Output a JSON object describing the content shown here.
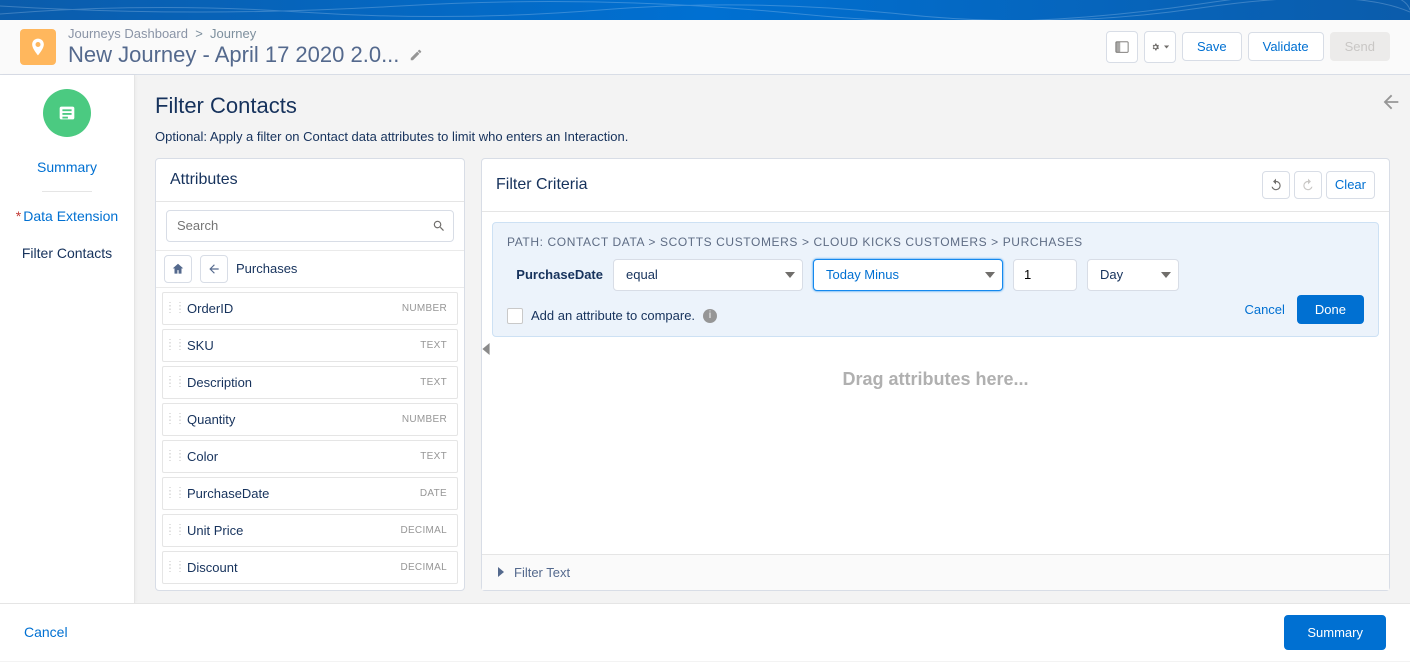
{
  "header": {
    "breadcrumb_dashboard": "Journeys Dashboard",
    "breadcrumb_journey": "Journey",
    "title": "New Journey - April 17 2020 2.0...",
    "actions": {
      "save": "Save",
      "validate": "Validate",
      "send": "Send"
    }
  },
  "nav": {
    "summary": "Summary",
    "data_extension": "Data Extension",
    "filter_contacts": "Filter Contacts"
  },
  "main": {
    "title": "Filter Contacts",
    "desc": "Optional: Apply a filter on Contact data attributes to limit who enters an Interaction."
  },
  "attributes_panel": {
    "title": "Attributes",
    "search_placeholder": "Search",
    "crumb": "Purchases",
    "items": [
      {
        "name": "OrderID",
        "type": "NUMBER"
      },
      {
        "name": "SKU",
        "type": "TEXT"
      },
      {
        "name": "Description",
        "type": "TEXT"
      },
      {
        "name": "Quantity",
        "type": "NUMBER"
      },
      {
        "name": "Color",
        "type": "TEXT"
      },
      {
        "name": "PurchaseDate",
        "type": "DATE"
      },
      {
        "name": "Unit Price",
        "type": "DECIMAL"
      },
      {
        "name": "Discount",
        "type": "DECIMAL"
      }
    ]
  },
  "criteria_panel": {
    "title": "Filter Criteria",
    "clear": "Clear",
    "path_label": "PATH:",
    "path": [
      "CONTACT DATA",
      "SCOTTS CUSTOMERS",
      "CLOUD KICKS CUSTOMERS",
      "PURCHASES"
    ],
    "rule": {
      "attribute": "PurchaseDate",
      "operator": "equal",
      "relative": "Today Minus",
      "value": "1",
      "unit": "Day",
      "compare_label": "Add an attribute to compare.",
      "cancel": "Cancel",
      "done": "Done"
    },
    "dropzone": "Drag attributes here...",
    "filter_text": "Filter Text"
  },
  "footer": {
    "cancel": "Cancel",
    "summary": "Summary"
  }
}
